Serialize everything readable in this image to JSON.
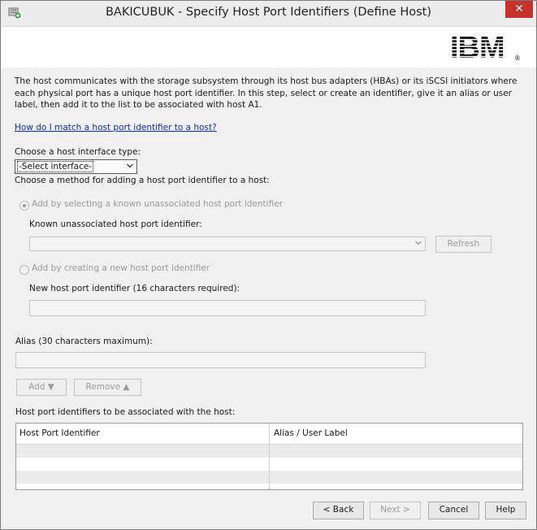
{
  "window": {
    "title": "BAKICUBUK - Specify Host Port Identifiers (Define Host)",
    "close_glyph": "✕"
  },
  "branding": {
    "logo_text": "IBM",
    "logo_mark": "®"
  },
  "intro": {
    "description": "The host communicates with the storage subsystem through its host bus adapters (HBAs) or its iSCSI initiators where each physical port has a unique host port identifier. In this step, select or create an identifier, give it an alias or user label, then add it to the list to be associated with host A1.",
    "help_link": "How do I match a host port identifier to a host?"
  },
  "interface": {
    "label": "Choose a host interface type:",
    "selected": "-Select interface-"
  },
  "method": {
    "label": "Choose a method for adding a host port identifier to a host:",
    "option_known": "Add by selecting a known unassociated host port identifier",
    "known_label": "Known unassociated host port identifier:",
    "known_value": "",
    "refresh": "Refresh",
    "option_new": "Add by creating a new host port identifier",
    "new_label": "New host port identifier (16 characters required):",
    "new_value": ""
  },
  "alias": {
    "label": "Alias (30 characters maximum):",
    "value": ""
  },
  "actions": {
    "add": "Add ▼",
    "remove": "Remove ▲"
  },
  "table": {
    "label": "Host port identifiers to be associated with the host:",
    "columns": [
      "Host Port Identifier",
      "Alias / User Label"
    ],
    "rows": []
  },
  "footer": {
    "back": "< Back",
    "next": "Next >",
    "cancel": "Cancel",
    "help": "Help"
  },
  "icons": {
    "app": "host-wizard-icon",
    "dropdown": "chevron-down-icon"
  },
  "colors": {
    "link": "#0a2fb0",
    "close": "#c7302b"
  }
}
